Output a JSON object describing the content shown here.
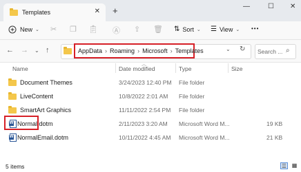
{
  "window": {
    "tab_title": "Templates",
    "tab_close": "✕",
    "new_tab": "+",
    "minimize": "—",
    "maximize": "☐",
    "close": "✕"
  },
  "toolbar": {
    "new_label": "New",
    "sort_label": "Sort",
    "view_label": "View",
    "more_label": "•••"
  },
  "address": {
    "crumbs": [
      "AppData",
      "Roaming",
      "Microsoft",
      "Templates"
    ],
    "search_placeholder": "Search ..."
  },
  "columns": {
    "name": "Name",
    "date": "Date modified",
    "type": "Type",
    "size": "Size"
  },
  "files": [
    {
      "name": "Document Themes",
      "date": "3/24/2023 12:40 PM",
      "type": "File folder",
      "size": "",
      "kind": "folder"
    },
    {
      "name": "LiveContent",
      "date": "10/8/2022 2:01 AM",
      "type": "File folder",
      "size": "",
      "kind": "folder"
    },
    {
      "name": "SmartArt Graphics",
      "date": "11/11/2022 2:54 PM",
      "type": "File folder",
      "size": "",
      "kind": "folder"
    },
    {
      "name": "Normal.dotm",
      "date": "2/11/2023 3:20 AM",
      "type": "Microsoft Word M...",
      "size": "19 KB",
      "kind": "word"
    },
    {
      "name": "NormalEmail.dotm",
      "date": "10/11/2022 4:45 AM",
      "type": "Microsoft Word M...",
      "size": "21 KB",
      "kind": "word"
    }
  ],
  "status": {
    "count_text": "5 items"
  },
  "colors": {
    "highlight_box": "#d61f26",
    "folder": "#f4c74b",
    "word_blue": "#2b5797"
  }
}
